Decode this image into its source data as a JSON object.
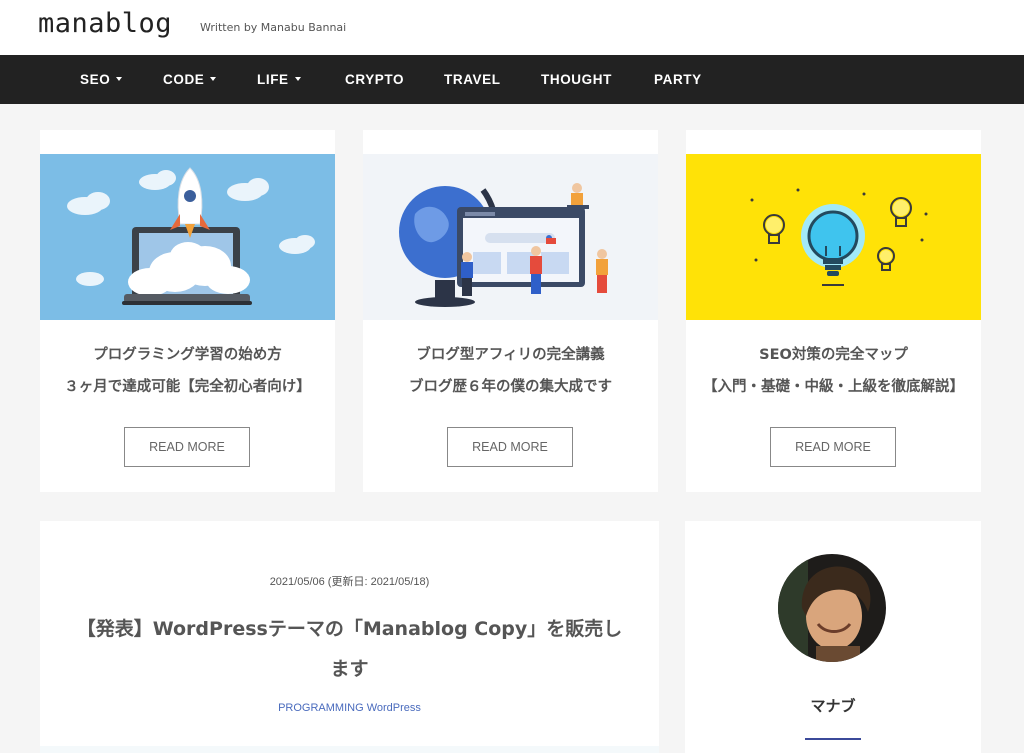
{
  "site": {
    "logo": "manablog",
    "tagline": "Written by Manabu Bannai"
  },
  "nav": {
    "items": [
      {
        "label": "SEO",
        "dropdown": true
      },
      {
        "label": "CODE",
        "dropdown": true
      },
      {
        "label": "LIFE",
        "dropdown": true
      },
      {
        "label": "CRYPTO",
        "dropdown": false
      },
      {
        "label": "TRAVEL",
        "dropdown": false
      },
      {
        "label": "THOUGHT",
        "dropdown": false
      },
      {
        "label": "PARTY",
        "dropdown": false
      }
    ]
  },
  "cards": [
    {
      "title_line1": "プログラミング学習の始め方",
      "title_line2": "３ヶ月で達成可能【完全初心者向け】",
      "button": "READ MORE",
      "image": "rocket-laptop-illustration",
      "image_bg": "#7cbde6"
    },
    {
      "title_line1": "ブログ型アフィリの完全講義",
      "title_line2": "ブログ歴６年の僕の集大成です",
      "button": "READ MORE",
      "image": "globe-browser-illustration",
      "image_bg": "#f1f4f8"
    },
    {
      "title_line1": "SEO対策の完全マップ",
      "title_line2": "【入門・基礎・中級・上級を徹底解説】",
      "button": "READ MORE",
      "image": "lightbulbs-illustration",
      "image_bg": "#ffe207"
    }
  ],
  "post": {
    "date": "2021/05/06 (更新日: 2021/05/18)",
    "title": "【発表】WordPressテーマの「Manablog Copy」を販売します",
    "categories": [
      "PROGRAMMING",
      "WordPress"
    ]
  },
  "sidebar": {
    "author_name": "マナブ",
    "avatar": "author-avatar-photo"
  },
  "colors": {
    "nav_bg": "#222222",
    "page_bg": "#f5f5f5",
    "link": "#4a6bbd",
    "accent_line": "#3b4a9a"
  }
}
